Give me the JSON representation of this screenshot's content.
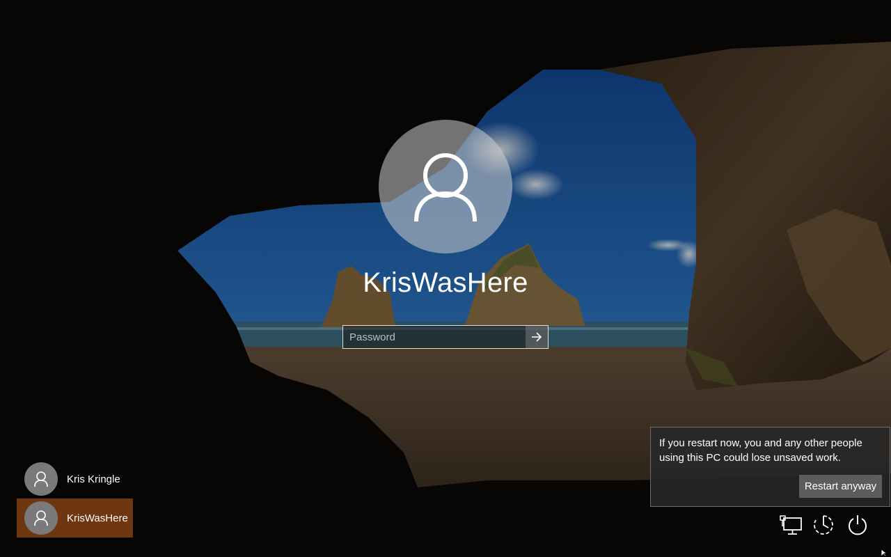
{
  "login": {
    "username": "KrisWasHere",
    "password_placeholder": "Password",
    "submit_icon": "arrow-right-icon"
  },
  "users": [
    {
      "name": "Kris Kringle",
      "selected": false,
      "icon": "user-icon"
    },
    {
      "name": "KrisWasHere",
      "selected": true,
      "icon": "user-icon"
    }
  ],
  "notice": {
    "message": "If you restart now, you and any other people using this PC could lose unsaved work.",
    "button_label": "Restart anyway"
  },
  "corner_icons": [
    "network-icon",
    "ease-of-access-icon",
    "power-icon"
  ],
  "colors": {
    "selected_user_bg": "#8c4414",
    "notice_bg": "#282828",
    "button_bg": "#5c5c5c"
  }
}
